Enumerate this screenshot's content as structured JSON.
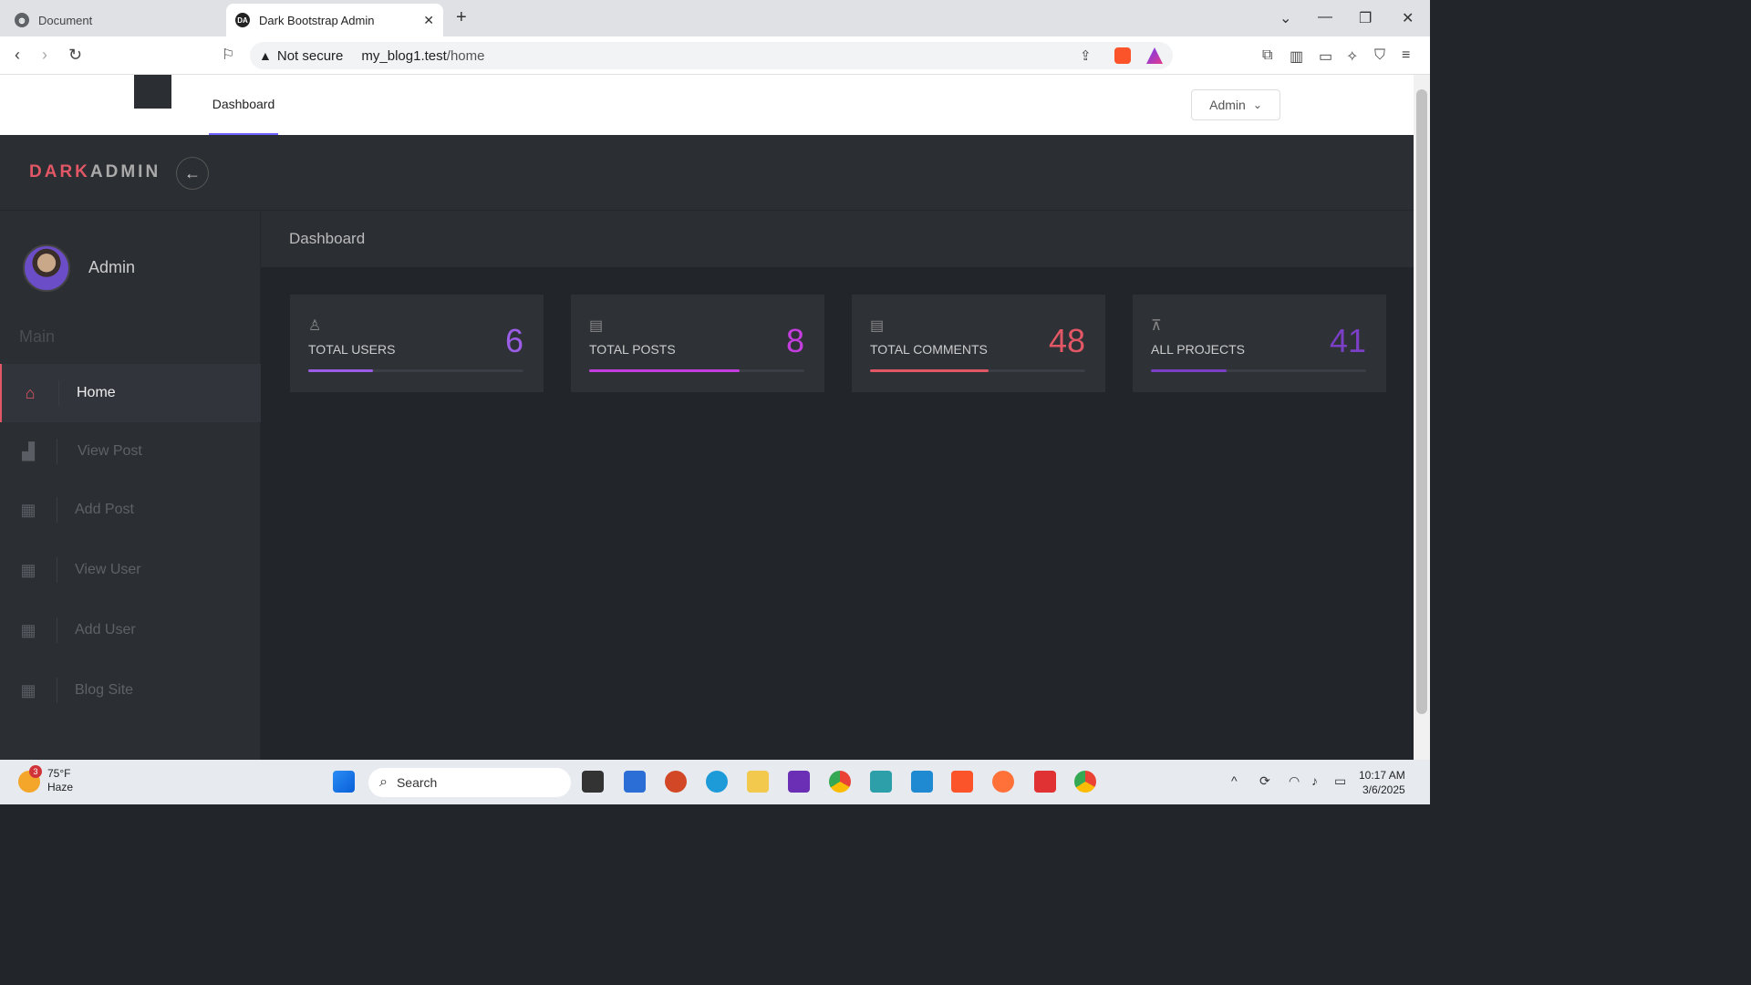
{
  "browser": {
    "tabs": [
      {
        "title": "Document",
        "favicon": "globe-icon"
      },
      {
        "title": "Dark Bootstrap Admin",
        "favicon": "DA",
        "active": true
      }
    ],
    "not_secure": "Not secure",
    "url_host": "my_blog1.test",
    "url_path": "/home"
  },
  "page_header": {
    "nav_link": "Dashboard",
    "user_menu": "Admin"
  },
  "brand": {
    "part1": "DARK",
    "part2": "ADMIN"
  },
  "sidebar": {
    "user_name": "Admin",
    "section": "Main",
    "items": [
      {
        "label": "Home",
        "icon": "home-icon",
        "active": true
      },
      {
        "label": "View Post",
        "icon": "bar-chart-icon"
      },
      {
        "label": "Add Post",
        "icon": "grid-icon"
      },
      {
        "label": "View User",
        "icon": "grid-icon"
      },
      {
        "label": "Add User",
        "icon": "grid-icon"
      },
      {
        "label": "Blog Site",
        "icon": "grid-icon"
      }
    ]
  },
  "main": {
    "title": "Dashboard",
    "cards": [
      {
        "label": "TOTAL USERS",
        "value": "6",
        "color": "#9b5de5",
        "progress": 0.3,
        "icon": "user-icon"
      },
      {
        "label": "TOTAL POSTS",
        "value": "8",
        "color": "#c43dde",
        "progress": 0.7,
        "icon": "document-icon"
      },
      {
        "label": "TOTAL COMMENTS",
        "value": "48",
        "color": "#e25765",
        "progress": 0.55,
        "icon": "comments-icon"
      },
      {
        "label": "ALL PROJECTS",
        "value": "41",
        "color": "#7a3fc4",
        "progress": 0.35,
        "icon": "projector-icon"
      }
    ]
  },
  "taskbar": {
    "weather_temp": "75°F",
    "weather_desc": "Haze",
    "weather_badge": "3",
    "search": "Search",
    "time": "10:17 AM",
    "date": "3/6/2025"
  },
  "colors": {
    "accent_red": "#e25765",
    "sidebar_bg": "#2b2e33",
    "content_bg": "#22252a"
  }
}
